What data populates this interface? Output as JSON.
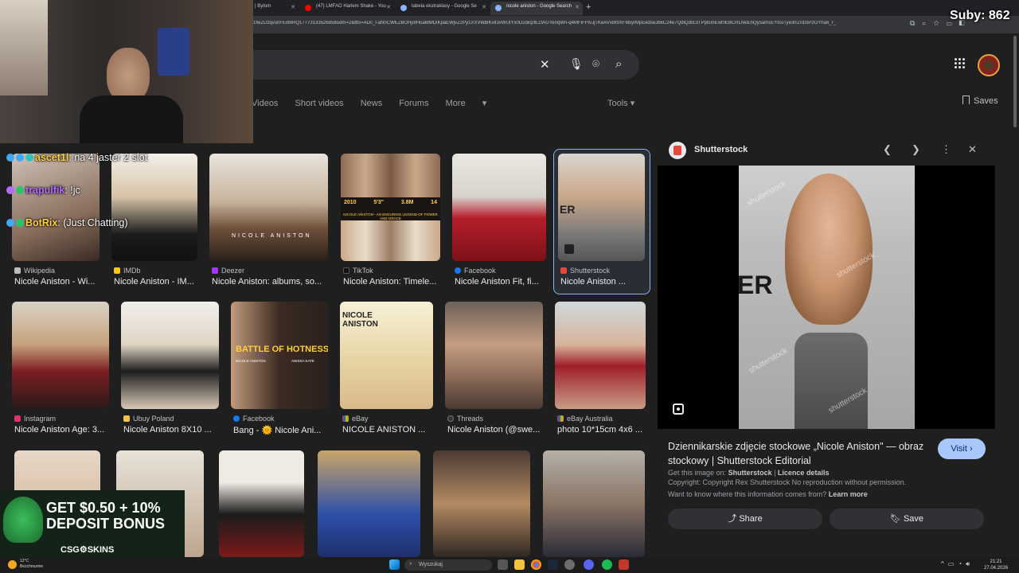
{
  "browser": {
    "tabs": [
      {
        "label": "| Bytom"
      },
      {
        "label": "(47) LMFAO Harlem Shake - You"
      },
      {
        "label": "tabela ekstraklasy - Google Se"
      },
      {
        "label": "nicole aniston - Google Search"
      }
    ],
    "new_tab": "+",
    "url": "1fwZDzqvunFEi89RQ17773133526858udm=2&fbs=ADc_l-aN0CWEZBOHjofHoaMMDiKpaEWjvZ2Py1XXV8d8KvlI3vWUtYx0D2dicpfE1fAGYenqWn-q4MFiFFtvJjTKeAVxBf9XF8ByrMpEedseJb6C24e7QdiQdIE3TPpl5mEwf0EBCRLNeEhQy5amsEYIcoTye3rrZrd3IP3OYha6_r_"
  },
  "google": {
    "nav_tabs": [
      "Videos",
      "Short videos",
      "News",
      "Forums",
      "More"
    ],
    "tools_label": "Tools",
    "saves_label": "Saves"
  },
  "results": [
    {
      "source": "Wikipedia",
      "caption": "Nicole Aniston - Wi...",
      "color": "#bdbdbd"
    },
    {
      "source": "IMDb",
      "caption": "Nicole Aniston - IM...",
      "color": "#f5c518"
    },
    {
      "source": "Deezer",
      "caption": "Nicole Aniston: albums, so...",
      "color": "#a238ff"
    },
    {
      "source": "TikTok",
      "caption": "Nicole Aniston: Timele...",
      "color": "#111111"
    },
    {
      "source": "Facebook",
      "caption": "Nicole Aniston Fit, fi...",
      "color": "#1877f2"
    },
    {
      "source": "Shutterstock",
      "caption": "Nicole Aniston ...",
      "color": "#e8483b"
    },
    {
      "source": "Instagram",
      "caption": "Nicole Aniston Age: 3...",
      "color": "#e1306c"
    },
    {
      "source": "Ubuy Poland",
      "caption": "Nicole Aniston 8X10 ...",
      "color": "#f5c542"
    },
    {
      "source": "Facebook",
      "caption": "Bang - 🌞 Nicole Ani...",
      "color": "#1877f2"
    },
    {
      "source": "eBay",
      "caption": "NICOLE ANISTON ...",
      "color": "#e53238"
    },
    {
      "source": "Threads",
      "caption": "Nicole Aniston (@swe...",
      "color": "#333333"
    },
    {
      "source": "eBay Australia",
      "caption": "photo 10*15cm 4x6 ...",
      "color": "#e53238"
    }
  ],
  "thumb_text": {
    "deezer": "NICOLE ANISTON",
    "tiktok_banner": "NICOLE ANISTON - AN ENDURING LEGEND OF POWER AND GRACE",
    "tiktok_stats": [
      "2010",
      "5'3\"",
      "3.8M",
      "14"
    ],
    "battle": "BATTLE OF HOTNESS",
    "battle_names": [
      "NICOLE ANISTON",
      "ANISSA KATE"
    ],
    "ebay_title": "NICOLE ANISTON"
  },
  "panel": {
    "source": "Shutterstock",
    "title": "Dziennikarskie zdjęcie stockowe „Nicole Aniston\" — obraz stockowy | Shutterstock Editorial",
    "visit_label": "Visit",
    "get_image_prefix": "Get this image on:",
    "get_image_source": "Shutterstock",
    "licence": "Licence details",
    "copyright": "Copyright: Copyright Rex Shutterstock No reproduction without permission.",
    "want_to_know": "Want to know where this information comes from?",
    "learn_more": "Learn more",
    "share_label": "Share",
    "save_label": "Save",
    "watermark": "shutterstock",
    "backdrop_text": "ER"
  },
  "stream": {
    "sub_counter": "Suby: 862",
    "chat": [
      {
        "user": "ascet1l",
        "message": "na 4 jaster 2 slot",
        "color": "#ffd23a"
      },
      {
        "user": "trapulfik",
        "message": "!jc",
        "color": "#b36bff"
      },
      {
        "user": "BotRix",
        "message": "(Just Chatting)",
        "color": "#ffd23a"
      }
    ],
    "promo_line1": "GET $0.50 + 10%",
    "promo_line2": "DEPOSIT BONUS",
    "promo_brand": "CSG⚙SKINS"
  },
  "taskbar": {
    "temperature": "12°C",
    "weather": "Bezchmurnie",
    "search_placeholder": "Wyszukaj",
    "time": "21:21",
    "date": "27.04.2026"
  }
}
